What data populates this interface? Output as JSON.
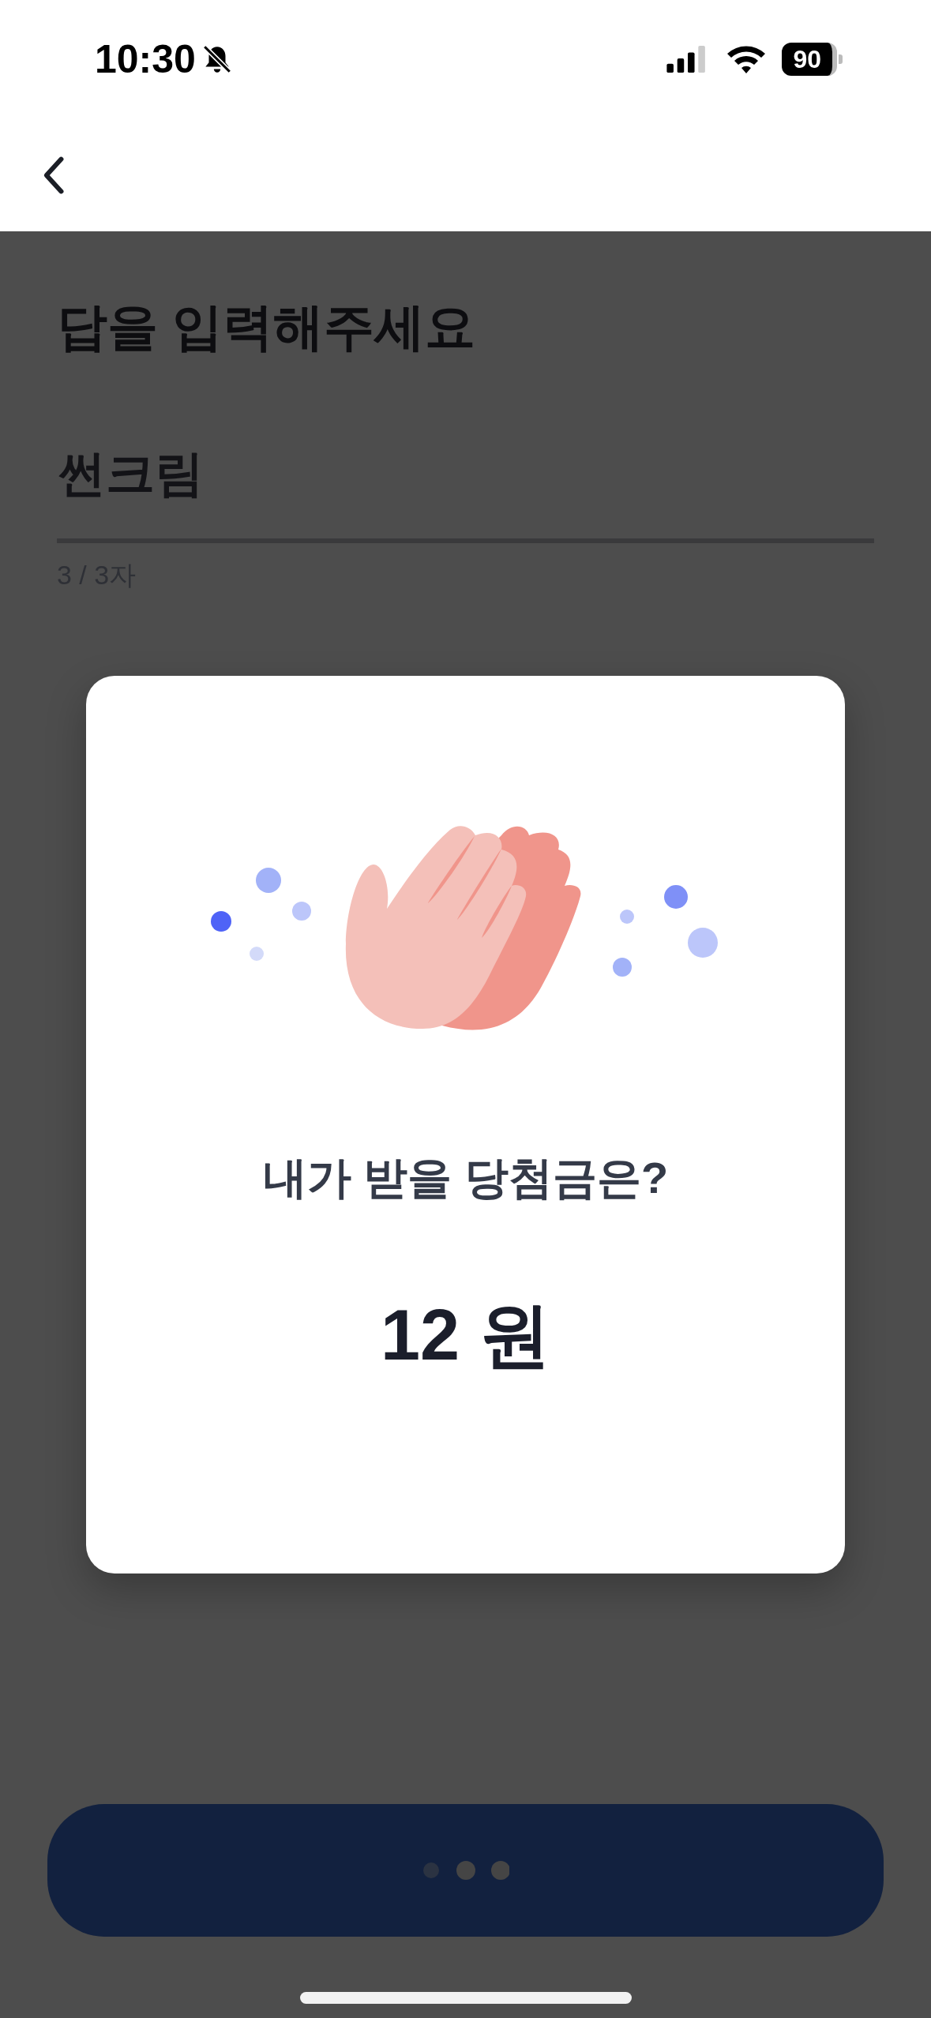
{
  "status_bar": {
    "time": "10:30",
    "battery": "90"
  },
  "title": "답을 입력해주세요",
  "answer_field": {
    "value": "썬크림",
    "counter": "3 / 3자"
  },
  "dialog": {
    "question": "내가 받을 당첨금은?",
    "amount": "12 원"
  },
  "submit_button": {
    "loading": true
  }
}
